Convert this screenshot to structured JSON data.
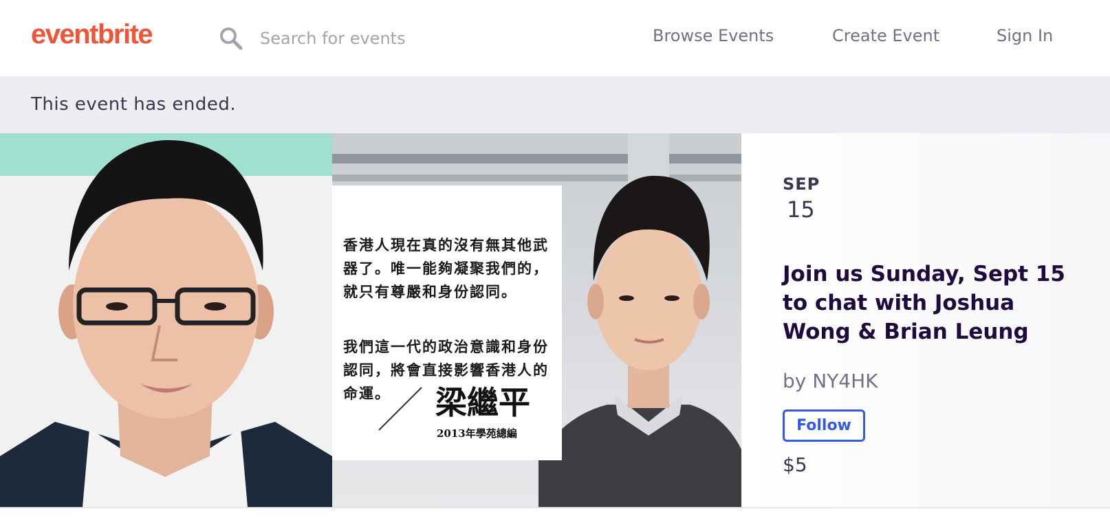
{
  "header": {
    "logo_text": "eventbrite",
    "search_placeholder": "Search for events",
    "nav": {
      "browse_events": "Browse Events",
      "create_event": "Create Event",
      "sign_in": "Sign In"
    }
  },
  "banner": {
    "text": "This event has ended."
  },
  "hero": {
    "quote_paragraph_1": "香港人現在真的沒有無其他武器了。唯一能夠凝聚我們的，就只有尊嚴和身份認同。",
    "quote_paragraph_2": "我們這一代的政治意識和身份認同，將會直接影響香港人的命運。",
    "quote_author": "梁繼平",
    "quote_author_title": "2013年學苑總編"
  },
  "event": {
    "month": "SEP",
    "day": "15",
    "title": "Join us Sunday, Sept 15 to chat with Joshua Wong & Brian Leung",
    "organizer": "by NY4HK",
    "follow_label": "Follow",
    "price": "$5"
  },
  "colors": {
    "brand": "#f05537",
    "follow_blue": "#3659e3",
    "banner_bg": "#eeedf2",
    "title_text": "#1e0a3c",
    "teal_accent": "#9fe0cf"
  }
}
